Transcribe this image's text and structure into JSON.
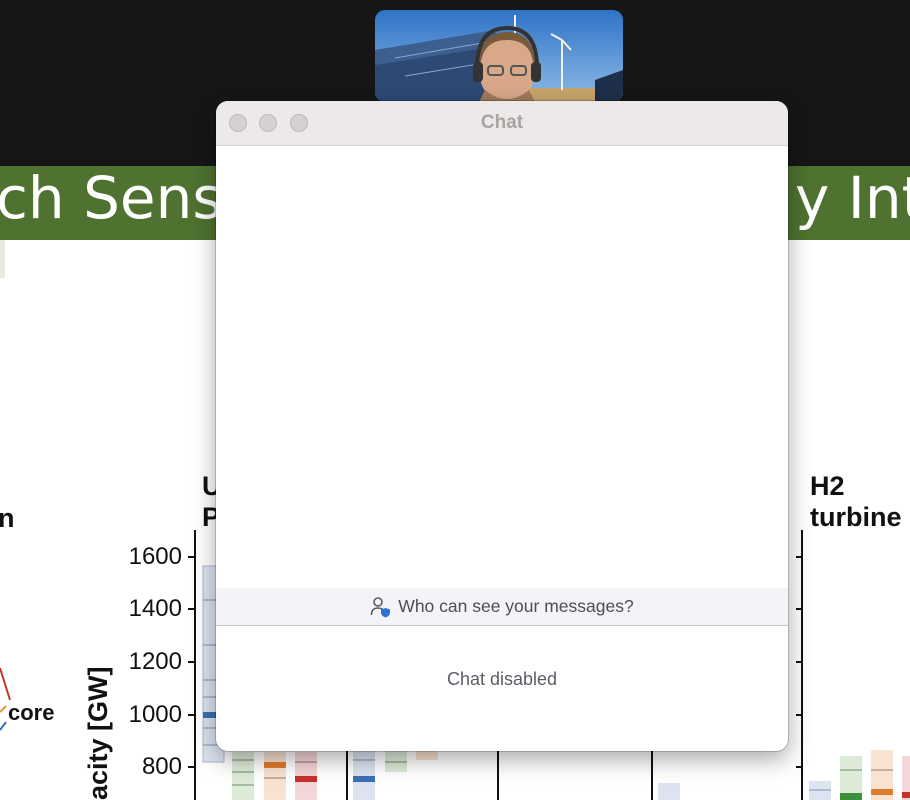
{
  "slide": {
    "banner_left": "ch Sensit",
    "banner_right": "y Inte",
    "panel_label_left": "n",
    "panel_label_mid_1": "U",
    "panel_label_mid_2": "P",
    "panel_label_right_1": "H2",
    "panel_label_right_2": "turbine",
    "legend_label": "core",
    "y_axis_label": "acity [GW]",
    "y_ticks": [
      "1600",
      "1400",
      "1200",
      "1000",
      "800"
    ]
  },
  "chat": {
    "title": "Chat",
    "visibility_prompt": "Who can see your messages?",
    "status": "Chat disabled"
  },
  "icons": {
    "window_close": "close-window-icon",
    "window_minimize": "minimize-window-icon",
    "window_zoom": "zoom-window-icon",
    "visibility": "person-shield-icon"
  },
  "colors": {
    "banner": "#4f7230",
    "accent_blue": "#3b6fb5",
    "status_text": "#5c5c66"
  }
}
